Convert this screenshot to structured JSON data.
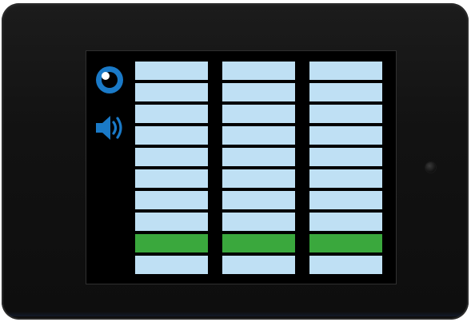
{
  "icons": {
    "visibility": "eye-icon",
    "audio": "volume-icon"
  },
  "colors": {
    "screen_background": "#000000",
    "cell_idle": "#bfe0f4",
    "cell_active": "#3aa83d",
    "icon_accent": "#1a7ac8",
    "bezel": "#141414"
  },
  "grid": {
    "columns": [
      {
        "active_row": 9,
        "rows": 10
      },
      {
        "active_row": 9,
        "rows": 10
      },
      {
        "active_row": 9,
        "rows": 10
      }
    ]
  }
}
